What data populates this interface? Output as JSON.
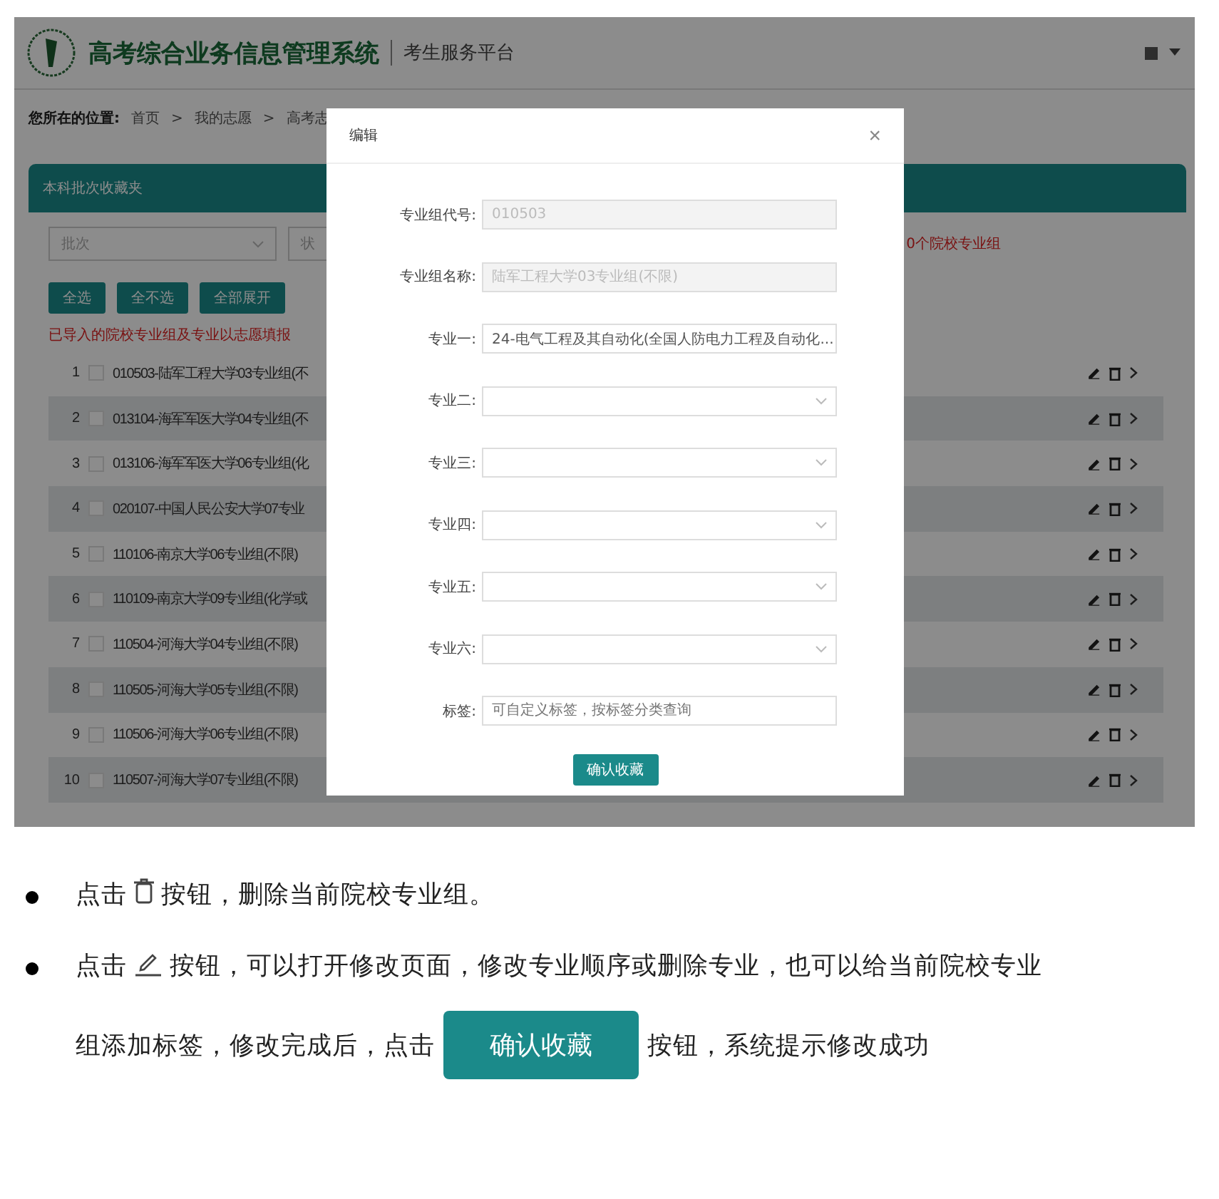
{
  "header": {
    "title": "高考综合业务信息管理系统",
    "subtitle": "考生服务平台"
  },
  "breadcrumb": {
    "label": "您所在的位置:",
    "items": [
      "首页",
      "我的志愿",
      "高考志"
    ],
    "separator": ">"
  },
  "panel": {
    "title": "本科批次收藏夹"
  },
  "filters": [
    {
      "placeholder": "批次"
    },
    {
      "placeholder": "状"
    }
  ],
  "toolbar_buttons": [
    "全选",
    "全不选",
    "全部展开"
  ],
  "notice_left": "已导入的院校专业组及专业以志愿填报",
  "notice_right": "0个院校专业组",
  "rows": [
    {
      "index": "1",
      "text": "010503-陆军工程大学03专业组(不",
      "checked": false
    },
    {
      "index": "2",
      "text": "013104-海军军医大学04专业组(不",
      "checked": false
    },
    {
      "index": "3",
      "text": "013106-海军军医大学06专业组(化",
      "checked": false
    },
    {
      "index": "4",
      "text": "020107-中国人民公安大学07专业",
      "checked": false
    },
    {
      "index": "5",
      "text": "110106-南京大学06专业组(不限)",
      "checked": false
    },
    {
      "index": "6",
      "text": "110109-南京大学09专业组(化学或",
      "checked": false
    },
    {
      "index": "7",
      "text": "110504-河海大学04专业组(不限)",
      "checked": false
    },
    {
      "index": "8",
      "text": "110505-河海大学05专业组(不限)",
      "checked": false
    },
    {
      "index": "9",
      "text": "110506-河海大学06专业组(不限)",
      "checked": false
    },
    {
      "index": "10",
      "text": "110507-河海大学07专业组(不限)",
      "checked": false
    }
  ],
  "modal": {
    "title": "编辑",
    "close": "×",
    "confirm": "确认收藏",
    "fields": [
      {
        "label": "专业组代号:",
        "kind": "text",
        "value": "010503",
        "disabled": true
      },
      {
        "label": "专业组名称:",
        "kind": "text",
        "value": "陆军工程大学03专业组(不限)",
        "disabled": true
      },
      {
        "label": "专业一:",
        "kind": "select",
        "value": "24-电气工程及其自动化(全国人防电力工程及自动化...",
        "disabled": false
      },
      {
        "label": "专业二:",
        "kind": "select",
        "disabled": false
      },
      {
        "label": "专业三:",
        "kind": "select",
        "disabled": false
      },
      {
        "label": "专业四:",
        "kind": "select",
        "disabled": false
      },
      {
        "label": "专业五:",
        "kind": "select",
        "disabled": false
      },
      {
        "label": "专业六:",
        "kind": "select",
        "disabled": false
      },
      {
        "label": "标签:",
        "kind": "text",
        "placeholder": "可自定义标签，按标签分类查询",
        "disabled": false
      }
    ]
  },
  "instructions": [
    [
      {
        "kind": "text",
        "text": "点击"
      },
      {
        "kind": "delete_icon"
      },
      {
        "kind": "text",
        "text": "按钮，删除当前院校专业组。"
      }
    ],
    [
      {
        "kind": "text",
        "text": "点击"
      },
      {
        "kind": "edit_icon"
      },
      {
        "kind": "text",
        "text": "按钮，可以打开修改页面，修改专业顺序或删除专业，也可以给当前院校专业"
      },
      {
        "kind": "break"
      },
      {
        "kind": "text",
        "text": "组添加标签，修改完成后，点击"
      },
      {
        "kind": "button",
        "text": "确认收藏"
      },
      {
        "kind": "text",
        "text": "按钮，系统提示修改成功"
      }
    ]
  ]
}
